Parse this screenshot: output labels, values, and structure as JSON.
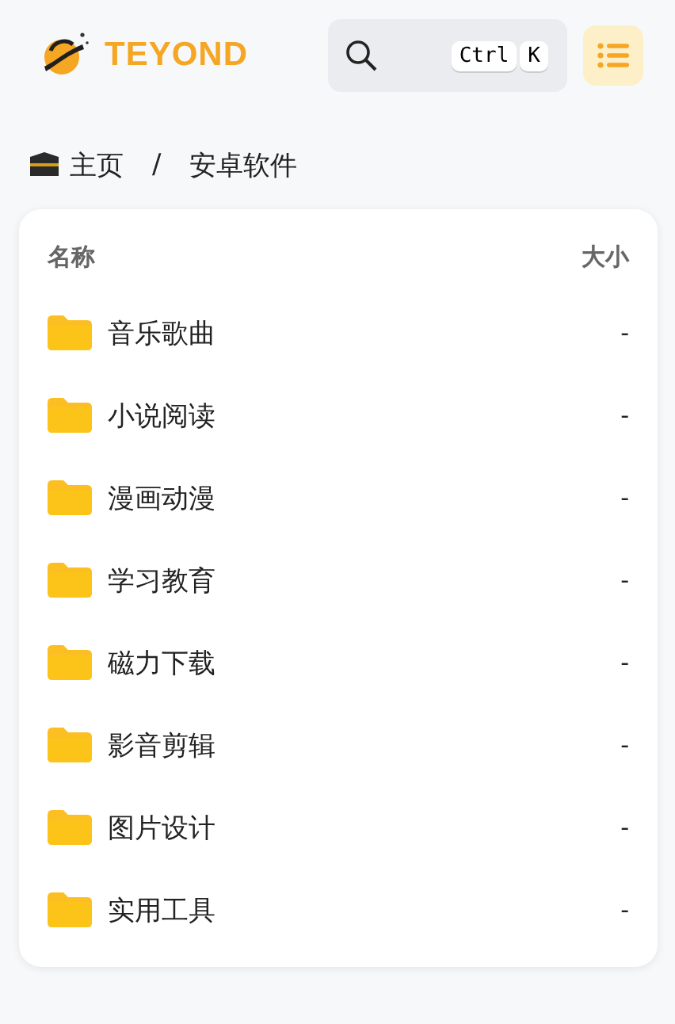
{
  "header": {
    "brand": "TEYOND",
    "search": {
      "keys": [
        "Ctrl",
        "K"
      ]
    }
  },
  "breadcrumb": [
    "主页",
    "安卓软件"
  ],
  "breadcrumb_separator": "/",
  "table": {
    "columns": [
      "名称",
      "大小"
    ],
    "rows": [
      {
        "name": "音乐歌曲",
        "size": "-"
      },
      {
        "name": "小说阅读",
        "size": "-"
      },
      {
        "name": "漫画动漫",
        "size": "-"
      },
      {
        "name": "学习教育",
        "size": "-"
      },
      {
        "name": "磁力下载",
        "size": "-"
      },
      {
        "name": "影音剪辑",
        "size": "-"
      },
      {
        "name": "图片设计",
        "size": "-"
      },
      {
        "name": "实用工具",
        "size": "-"
      }
    ]
  }
}
